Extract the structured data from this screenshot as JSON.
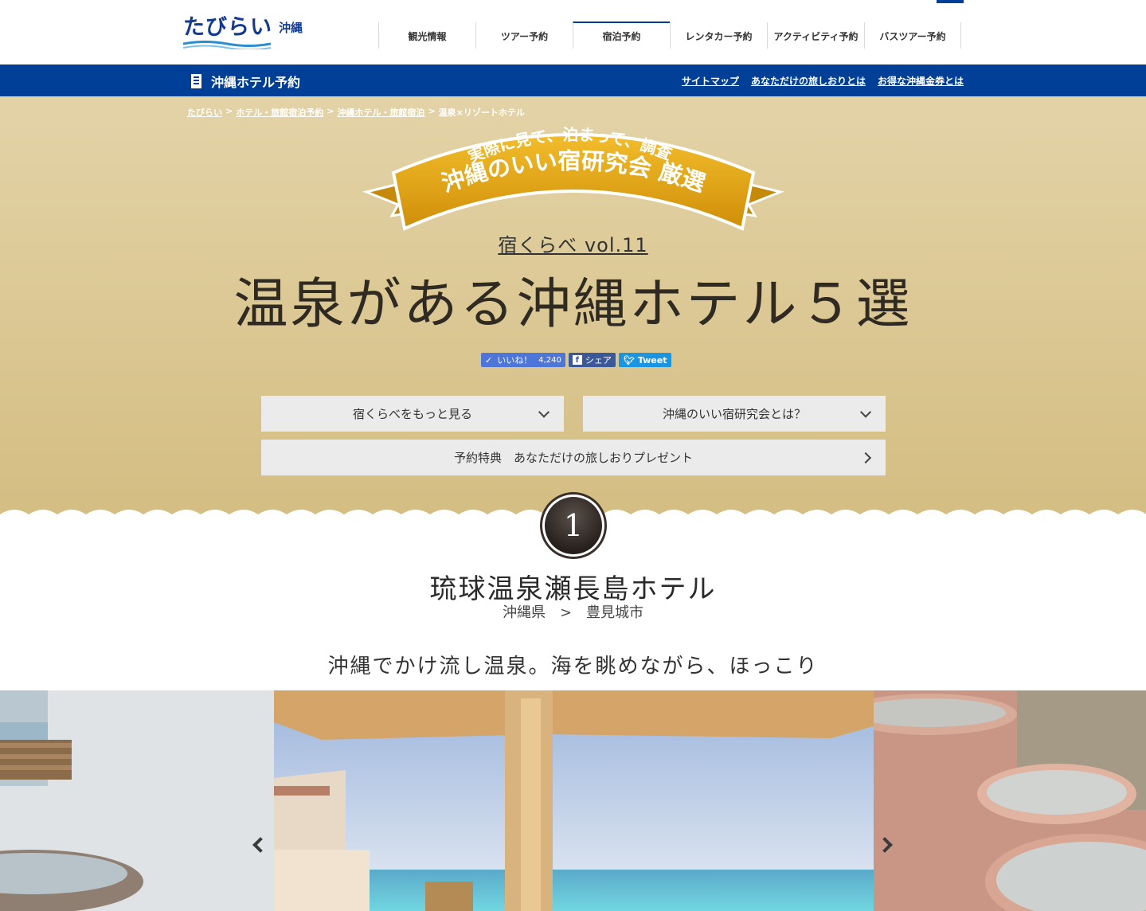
{
  "header": {
    "logo_text": "たびらい",
    "logo_sub": "沖縄",
    "nav": [
      {
        "label": "観光情報",
        "active": false
      },
      {
        "label": "ツアー予約",
        "active": false
      },
      {
        "label": "宿泊予約",
        "active": true
      },
      {
        "label": "レンタカー予約",
        "active": false
      },
      {
        "label": "アクティビティ予約",
        "active": false
      },
      {
        "label": "バスツアー予約",
        "active": false
      }
    ]
  },
  "bluebar": {
    "title": "沖縄ホテル予約",
    "links": [
      "サイトマップ",
      "あなただけの旅しおりとは",
      "お得な沖縄金券とは"
    ]
  },
  "breadcrumb": {
    "items": [
      "たびらい",
      "ホテル・旅館宿泊予約",
      "沖縄ホテル・旅館宿泊",
      "温泉×リゾートホテル"
    ],
    "separator": ">"
  },
  "ribbon": {
    "line1": "実際に見て、泊まって、調査!",
    "line2": "沖縄のいい宿研究会 厳選"
  },
  "hero": {
    "subtitle": "宿くらべ vol.11",
    "title": "温泉がある沖縄ホテル５選"
  },
  "social": {
    "like_label": "いいね！",
    "like_count": "4,240",
    "share_label": "シェア",
    "tweet_label": "Tweet"
  },
  "menu": {
    "more_compare": "宿くらべをもっと見る",
    "about_society": "沖縄のいい宿研究会とは？",
    "benefit": "予約特典　あなただけの旅しおりプレゼント"
  },
  "hotel": {
    "rank": "1",
    "name": "琉球温泉瀬長島ホテル",
    "location": "沖縄県　>　豊見城市",
    "catch": "沖縄でかけ流し温泉。海を眺めながら、ほっこり"
  },
  "colors": {
    "brand_blue": "#003f98",
    "ribbon_gold": "#e0a414",
    "hero_top": "#e3d3a7",
    "hero_bottom": "#d4bd82"
  }
}
